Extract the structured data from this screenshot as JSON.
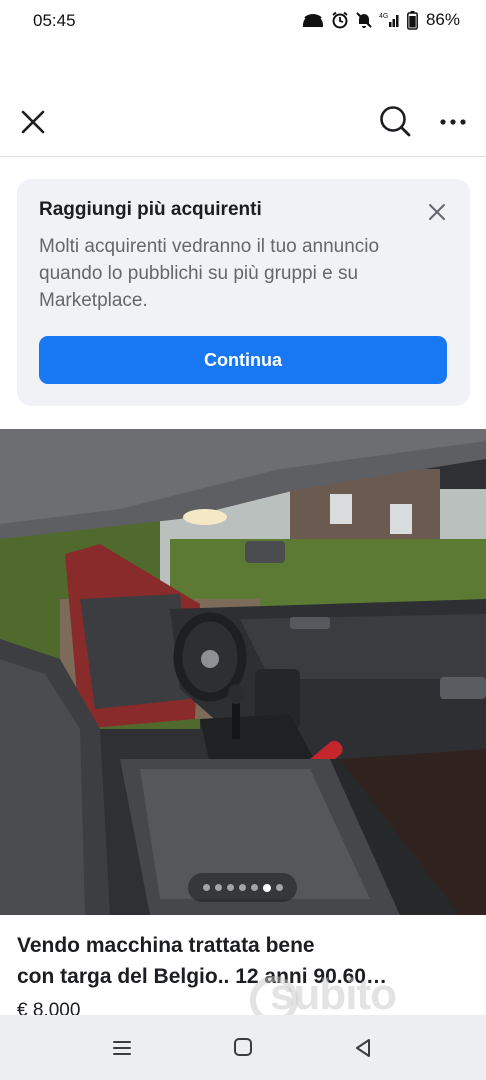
{
  "status_bar": {
    "time": "05:45",
    "battery": "86%",
    "icons": [
      "wifi-hotspot-icon",
      "alarm-icon",
      "mute-icon",
      "signal-4g-icon",
      "battery-icon"
    ]
  },
  "nav": {
    "close_icon": "close-icon",
    "search_icon": "search-icon",
    "more_icon": "more-icon"
  },
  "promo": {
    "title": "Raggiungi più acquirenti",
    "body": "Molti acquirenti vedranno il tuo annuncio quando lo pubblichi su più gruppi e su Marketplace.",
    "button_label": "Continua",
    "accent": "#1877f2"
  },
  "gallery": {
    "dot_count": 7,
    "active_index": 5
  },
  "listing": {
    "title_line1": "Vendo macchina trattata bene",
    "title_line2": "con targa del Belgio.. 12 anni 90.60…",
    "price": "€ 8.000",
    "watermark": "subito"
  }
}
